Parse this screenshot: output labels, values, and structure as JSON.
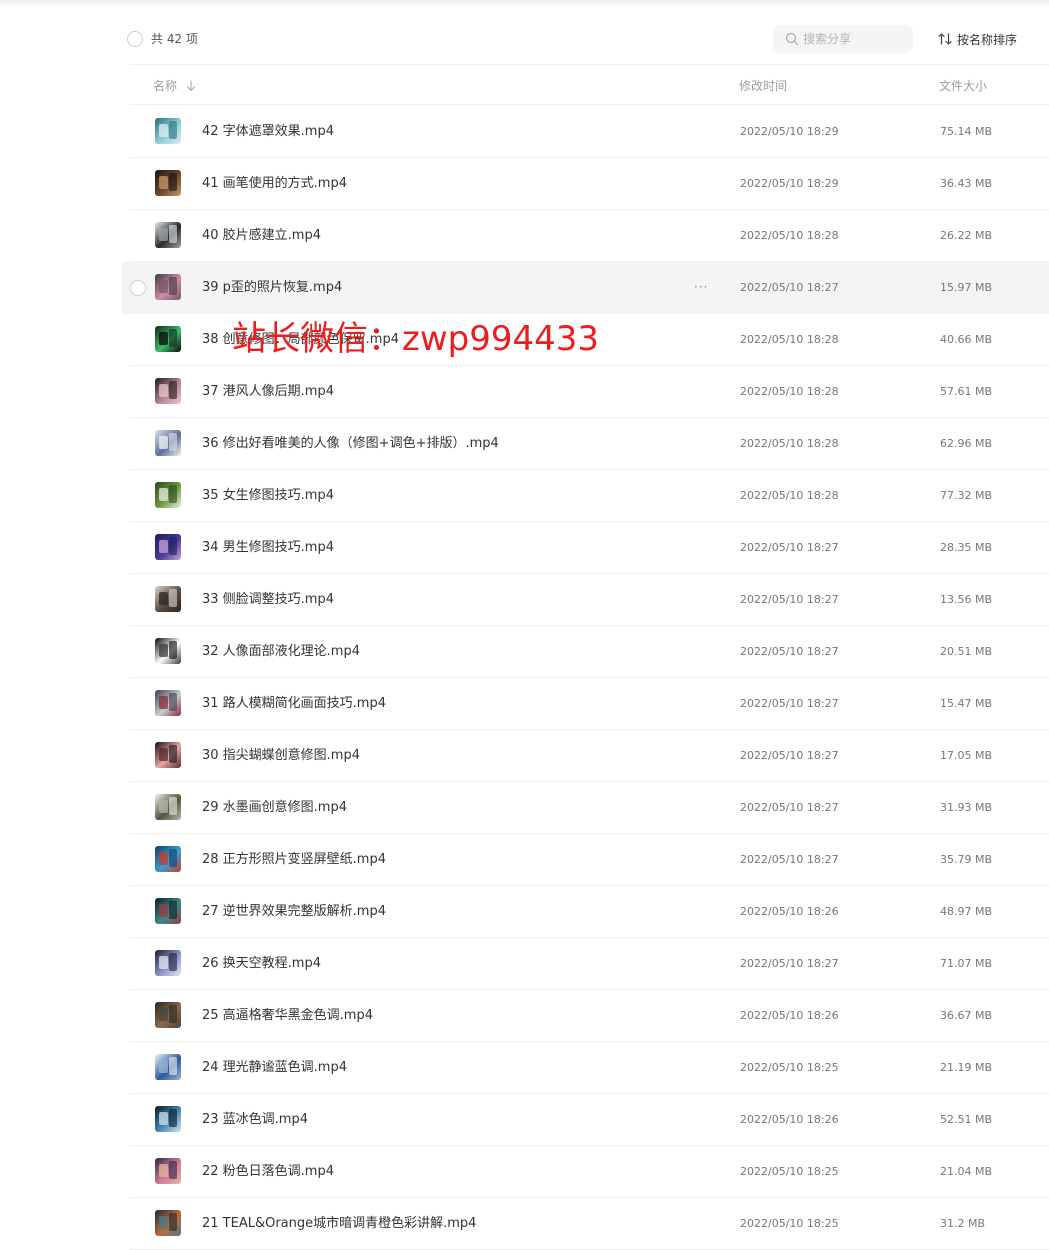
{
  "toolbar": {
    "total_label": "共 42 项",
    "search_placeholder": "搜索分享",
    "sort_label": "按名称排序"
  },
  "columns": {
    "name": "名称",
    "modified": "修改时间",
    "size": "文件大小"
  },
  "watermark": "站长微信：zwp994433",
  "files": [
    {
      "name": "42 字体遮罩效果.mp4",
      "time": "2022/05/10 18:29",
      "size": "75.14 MB",
      "thumb": [
        "#2c6f7d",
        "#8fd0d8",
        "#dfeef0"
      ]
    },
    {
      "name": "41 画笔使用的方式.mp4",
      "time": "2022/05/10 18:29",
      "size": "36.43 MB",
      "thumb": [
        "#1b1410",
        "#6a4a32",
        "#c99a6a"
      ]
    },
    {
      "name": "40 胶片感建立.mp4",
      "time": "2022/05/10 18:28",
      "size": "26.22 MB",
      "thumb": [
        "#e6e8ea",
        "#2a2a2a",
        "#9aa3a8"
      ]
    },
    {
      "name": "39 p歪的照片恢复.mp4",
      "time": "2022/05/10 18:27",
      "size": "15.97 MB",
      "thumb": [
        "#3b3a3f",
        "#d08aa7",
        "#7a5a6a"
      ],
      "hover": true
    },
    {
      "name": "38 创意修图：局部颜色保留.mp4",
      "time": "2022/05/10 18:28",
      "size": "40.66 MB",
      "thumb": [
        "#0f2a1a",
        "#3dbb6a",
        "#0a0a0a"
      ]
    },
    {
      "name": "37 港风人像后期.mp4",
      "time": "2022/05/10 18:28",
      "size": "57.61 MB",
      "thumb": [
        "#1d1a20",
        "#b9868f",
        "#e9c7cc"
      ]
    },
    {
      "name": "36 修出好看唯美的人像（修图+调色+排版）.mp4",
      "time": "2022/05/10 18:28",
      "size": "62.96 MB",
      "thumb": [
        "#dfe3ea",
        "#5c6f9a",
        "#f3f3f3"
      ]
    },
    {
      "name": "35 女生修图技巧.mp4",
      "time": "2022/05/10 18:28",
      "size": "77.32 MB",
      "thumb": [
        "#2a4a1e",
        "#6f9a3c",
        "#e9efe6"
      ]
    },
    {
      "name": "34 男生修图技巧.mp4",
      "time": "2022/05/10 18:27",
      "size": "28.35 MB",
      "thumb": [
        "#1a1f5c",
        "#4a3a9a",
        "#c7a3d6"
      ]
    },
    {
      "name": "33 侧脸调整技巧.mp4",
      "time": "2022/05/10 18:27",
      "size": "13.56 MB",
      "thumb": [
        "#d9d5cf",
        "#5a4a3e",
        "#2a2522"
      ]
    },
    {
      "name": "32 人像面部液化理论.mp4",
      "time": "2022/05/10 18:27",
      "size": "20.51 MB",
      "thumb": [
        "#0a0a0a",
        "#ffffff",
        "#3a3a3a"
      ]
    },
    {
      "name": "31 路人模糊简化画面技巧.mp4",
      "time": "2022/05/10 18:27",
      "size": "15.47 MB",
      "thumb": [
        "#3a3f4a",
        "#c9ccd4",
        "#8a2a3a"
      ]
    },
    {
      "name": "30 指尖蝴蝶创意修图.mp4",
      "time": "2022/05/10 18:27",
      "size": "17.05 MB",
      "thumb": [
        "#121212",
        "#e8a6a6",
        "#5a2a2a"
      ]
    },
    {
      "name": "29 水墨画创意修图.mp4",
      "time": "2022/05/10 18:27",
      "size": "31.93 MB",
      "thumb": [
        "#efeee8",
        "#4a5a3a",
        "#b8b6a8"
      ]
    },
    {
      "name": "28 正方形照片变竖屏壁纸.mp4",
      "time": "2022/05/10 18:27",
      "size": "35.79 MB",
      "thumb": [
        "#0f3f6a",
        "#3aa0d0",
        "#c83a2a"
      ]
    },
    {
      "name": "27 逆世界效果完整版解析.mp4",
      "time": "2022/05/10 18:26",
      "size": "48.97 MB",
      "thumb": [
        "#0e1e22",
        "#3a8a8a",
        "#9a3a4a"
      ]
    },
    {
      "name": "26 换天空教程.mp4",
      "time": "2022/05/10 18:27",
      "size": "71.07 MB",
      "thumb": [
        "#1c1f3a",
        "#8a92c6",
        "#e8e8f0"
      ]
    },
    {
      "name": "25 高逼格奢华黑金色调.mp4",
      "time": "2022/05/10 18:26",
      "size": "36.67 MB",
      "thumb": [
        "#2a2622",
        "#8a6a4a",
        "#4a4440"
      ]
    },
    {
      "name": "24 理光静谧蓝色调.mp4",
      "time": "2022/05/10 18:25",
      "size": "21.19 MB",
      "thumb": [
        "#f2f4f6",
        "#2a5a9a",
        "#9ab4d0"
      ]
    },
    {
      "name": "23 蓝冰色调.mp4",
      "time": "2022/05/10 18:26",
      "size": "52.51 MB",
      "thumb": [
        "#0a1a2a",
        "#4a8ab0",
        "#d0e4ef"
      ]
    },
    {
      "name": "22 粉色日落色调.mp4",
      "time": "2022/05/10 18:25",
      "size": "21.04 MB",
      "thumb": [
        "#2a2a4a",
        "#d07a9a",
        "#e8b4a0"
      ]
    },
    {
      "name": "21 TEAL&Orange城市暗调青橙色彩讲解.mp4",
      "time": "2022/05/10 18:25",
      "size": "31.2 MB",
      "thumb": [
        "#1a2a30",
        "#c06a3a",
        "#4a7a8a"
      ]
    }
  ]
}
